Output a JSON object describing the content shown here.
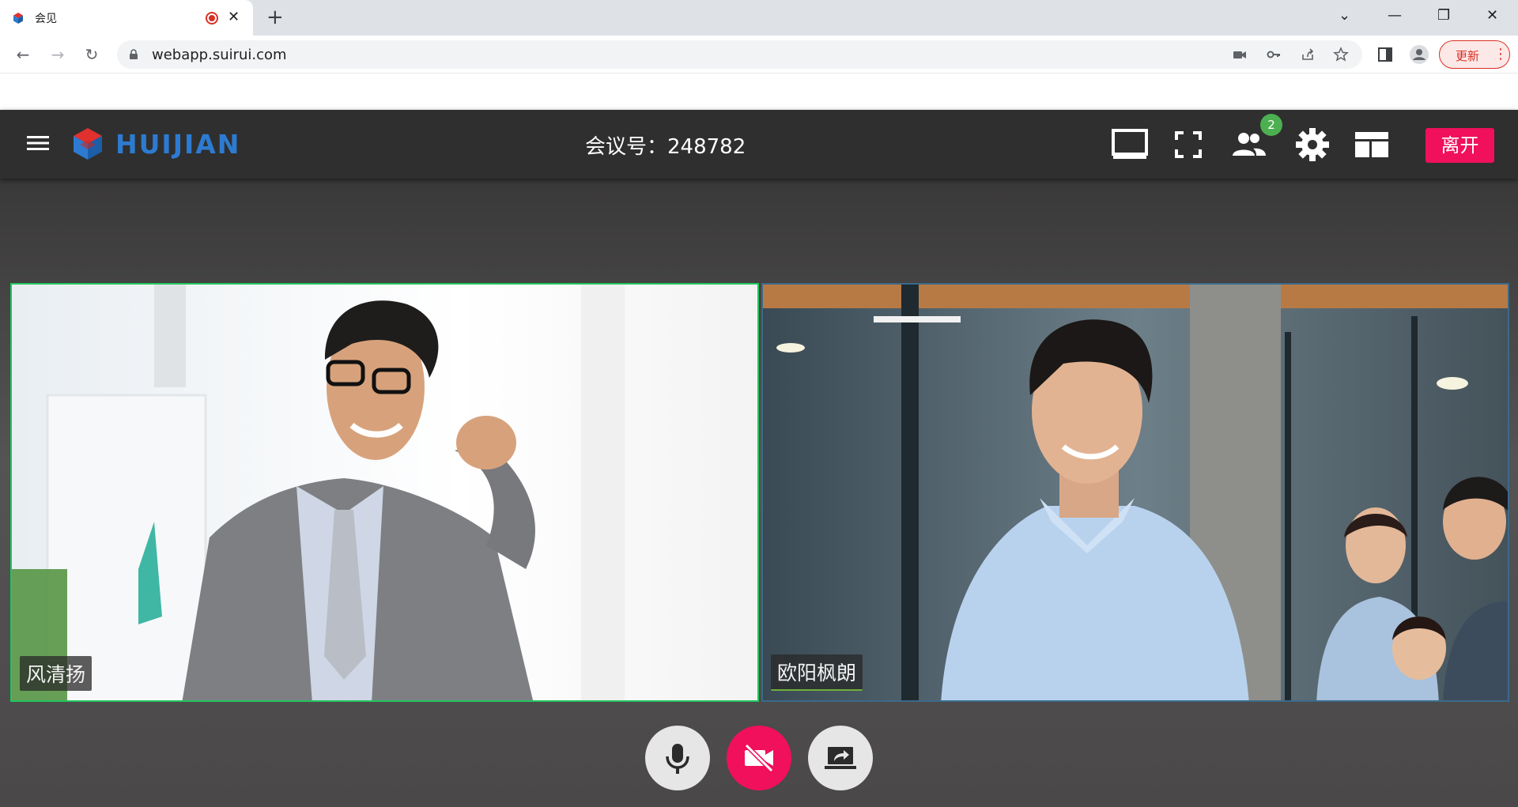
{
  "browser": {
    "tab_title": "会见",
    "tab_close": "✕",
    "new_tab": "+",
    "window_controls": {
      "tabsearch": "⌄",
      "minimize": "—",
      "restore": "❐",
      "close": "✕"
    },
    "url": "webapp.suirui.com",
    "update_label": "更新",
    "menu_dots": "⋮",
    "nav": {
      "back": "←",
      "forward": "→",
      "reload": "↻"
    }
  },
  "header": {
    "brand": "HUIJIAN",
    "meeting_number": "会议号：248782",
    "participants_count": "2",
    "leave_label": "离开"
  },
  "videos": [
    {
      "name": "风清扬",
      "active": false
    },
    {
      "name": "欧阳枫朗",
      "active": true
    }
  ],
  "controls": [
    "microphone",
    "camera-off",
    "share-screen"
  ],
  "colors": {
    "header_bg": "#2f2f2f",
    "brand": "#2d7bd1",
    "leave": "#f0105c",
    "badge": "#4caf50",
    "active_border": "#22c55e"
  }
}
